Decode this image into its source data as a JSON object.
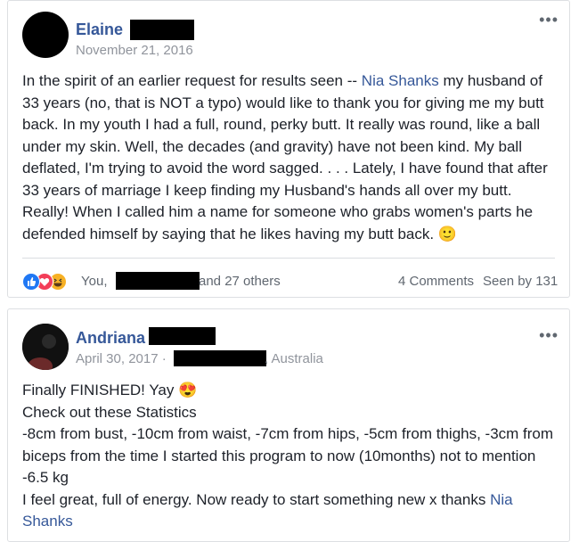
{
  "posts": [
    {
      "author": "Elaine",
      "date": "November 21, 2016",
      "more": "•••",
      "body_pre": "In the spirit of an earlier request for results seen -- ",
      "body_link": "Nia Shanks",
      "body_post": " my husband of 33 years (no, that is NOT a typo) would like to thank you for giving me my butt back. In my youth I had a full, round, perky butt. It really was round, like a ball under my skin. Well, the decades (and gravity) have not been kind. My ball deflated, I'm trying to avoid the word sagged. . . . Lately, I have found that after 33 years of marriage I keep finding my Husband's hands all over my butt. Really! When I called him a name for someone who grabs women's parts he defended himself by saying that he likes having my butt back. ",
      "emoji": "🙂",
      "reactions_prefix": "You,",
      "reactions_suffix": "and 27 others",
      "comments": "4 Comments",
      "seen": "Seen by 131"
    },
    {
      "author": "Andriana",
      "date": "April 30, 2017 ·",
      "location": ", Australia",
      "more": "•••",
      "line1": "Finally FINISHED! Yay ",
      "emoji": "😍",
      "line2": "Check out these Statistics",
      "line3": "-8cm from bust, -10cm from waist, -7cm from hips, -5cm from thighs, -3cm from biceps from the time I started this program to now (10months) not to mention -6.5 kg",
      "line4": "I feel great, full of energy. Now ready to start something new x thanks ",
      "line4_link": "Nia Shanks"
    }
  ],
  "colors": {
    "link": "#365899",
    "like": "#2078f4",
    "love": "#f33e58",
    "haha": "#f7b125"
  },
  "icons": [
    "like-reaction-icon",
    "love-reaction-icon",
    "haha-reaction-icon"
  ]
}
